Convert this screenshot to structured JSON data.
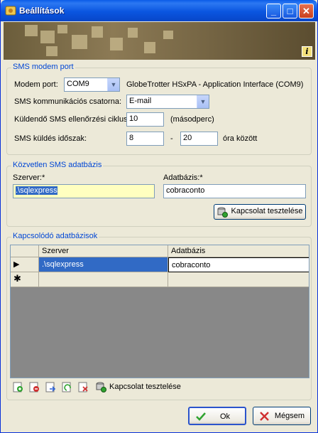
{
  "window": {
    "title": "Beállítások",
    "minimize": "_",
    "maximize": "□",
    "close": "✕"
  },
  "banner": {
    "info_glyph": "i"
  },
  "sms_modem": {
    "legend": "SMS modem port",
    "port_label": "Modem port:",
    "port_value": "COM9",
    "port_description": "GlobeTrotter HSxPA - Application Interface (COM9)",
    "channel_label": "SMS kommunikációs csatorna:",
    "channel_value": "E-mail",
    "check_label": "Küldendő SMS ellenőrzési ciklus:",
    "check_value": "10",
    "check_unit": "(másodperc)",
    "period_label": "SMS küldés időszak:",
    "period_from": "8",
    "period_sep": "-",
    "period_to": "20",
    "period_unit": "óra között"
  },
  "direct_db": {
    "legend": "Közvetlen SMS adatbázis",
    "server_label": "Szerver:*",
    "server_value": ".\\sqlexpress",
    "database_label": "Adatbázis:*",
    "database_value": "cobraconto",
    "test_button": "Kapcsolat tesztelése"
  },
  "linked_dbs": {
    "legend": "Kapcsolódó adatbázisok",
    "columns": [
      "Szerver",
      "Adatbázis"
    ],
    "rows": [
      {
        "server": ".\\sqlexpress",
        "database": "cobraconto",
        "marker": "▶"
      }
    ],
    "new_row_marker": "✱",
    "toolbar": {
      "test_button": "Kapcsolat tesztelése"
    }
  },
  "footer": {
    "ok_label": "Ok",
    "cancel_label": "Mégsem"
  },
  "colors": {
    "accent": "#0046d5",
    "selection": "#316ac5",
    "highlight_input": "#ffffc0"
  }
}
